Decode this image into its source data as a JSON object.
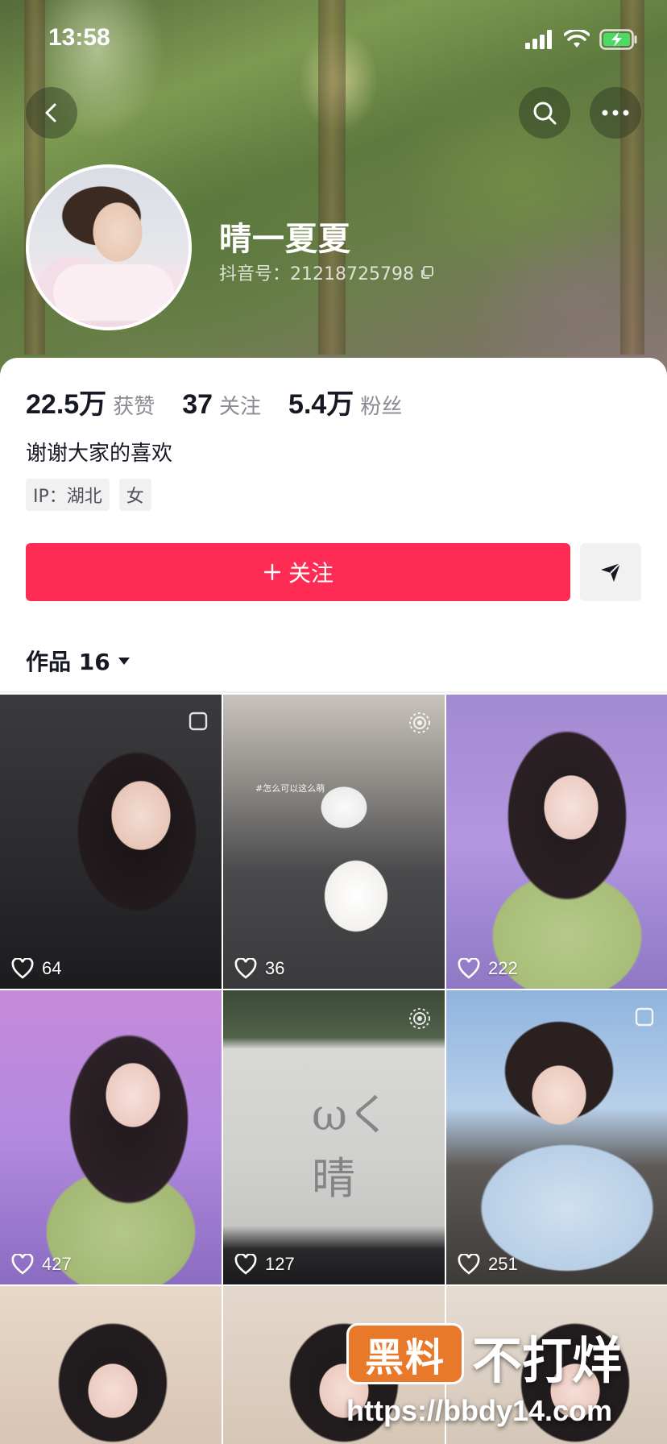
{
  "status_bar": {
    "time": "13:58"
  },
  "profile": {
    "name": "晴一夏夏",
    "douyin_id": "抖音号：21218725798",
    "bio": "谢谢大家的喜欢",
    "tags": [
      "IP：湖北",
      "女"
    ]
  },
  "stats": [
    {
      "value": "22.5万",
      "label": "获赞"
    },
    {
      "value": "37",
      "label": "关注"
    },
    {
      "value": "5.4万",
      "label": "粉丝"
    }
  ],
  "actions": {
    "follow_label": "关注"
  },
  "works_tab": {
    "label": "作品 16"
  },
  "videos": [
    {
      "likes": "64",
      "badge": "pin"
    },
    {
      "likes": "36",
      "badge": "live",
      "caption": "#怎么可以这么萌"
    },
    {
      "likes": "222"
    },
    {
      "likes": "427"
    },
    {
      "likes": "127",
      "badge": "live",
      "text": "ωく 晴"
    },
    {
      "likes": "251",
      "badge": "pin"
    },
    {
      "likes": ""
    },
    {
      "likes": ""
    },
    {
      "likes": ""
    }
  ],
  "watermark": {
    "box_text": "黑料",
    "big_text": "不打烊",
    "url": "https://bbdy14.com"
  },
  "colors": {
    "accent": "#fe2c55",
    "text": "#161823",
    "muted": "#8a8b91"
  }
}
